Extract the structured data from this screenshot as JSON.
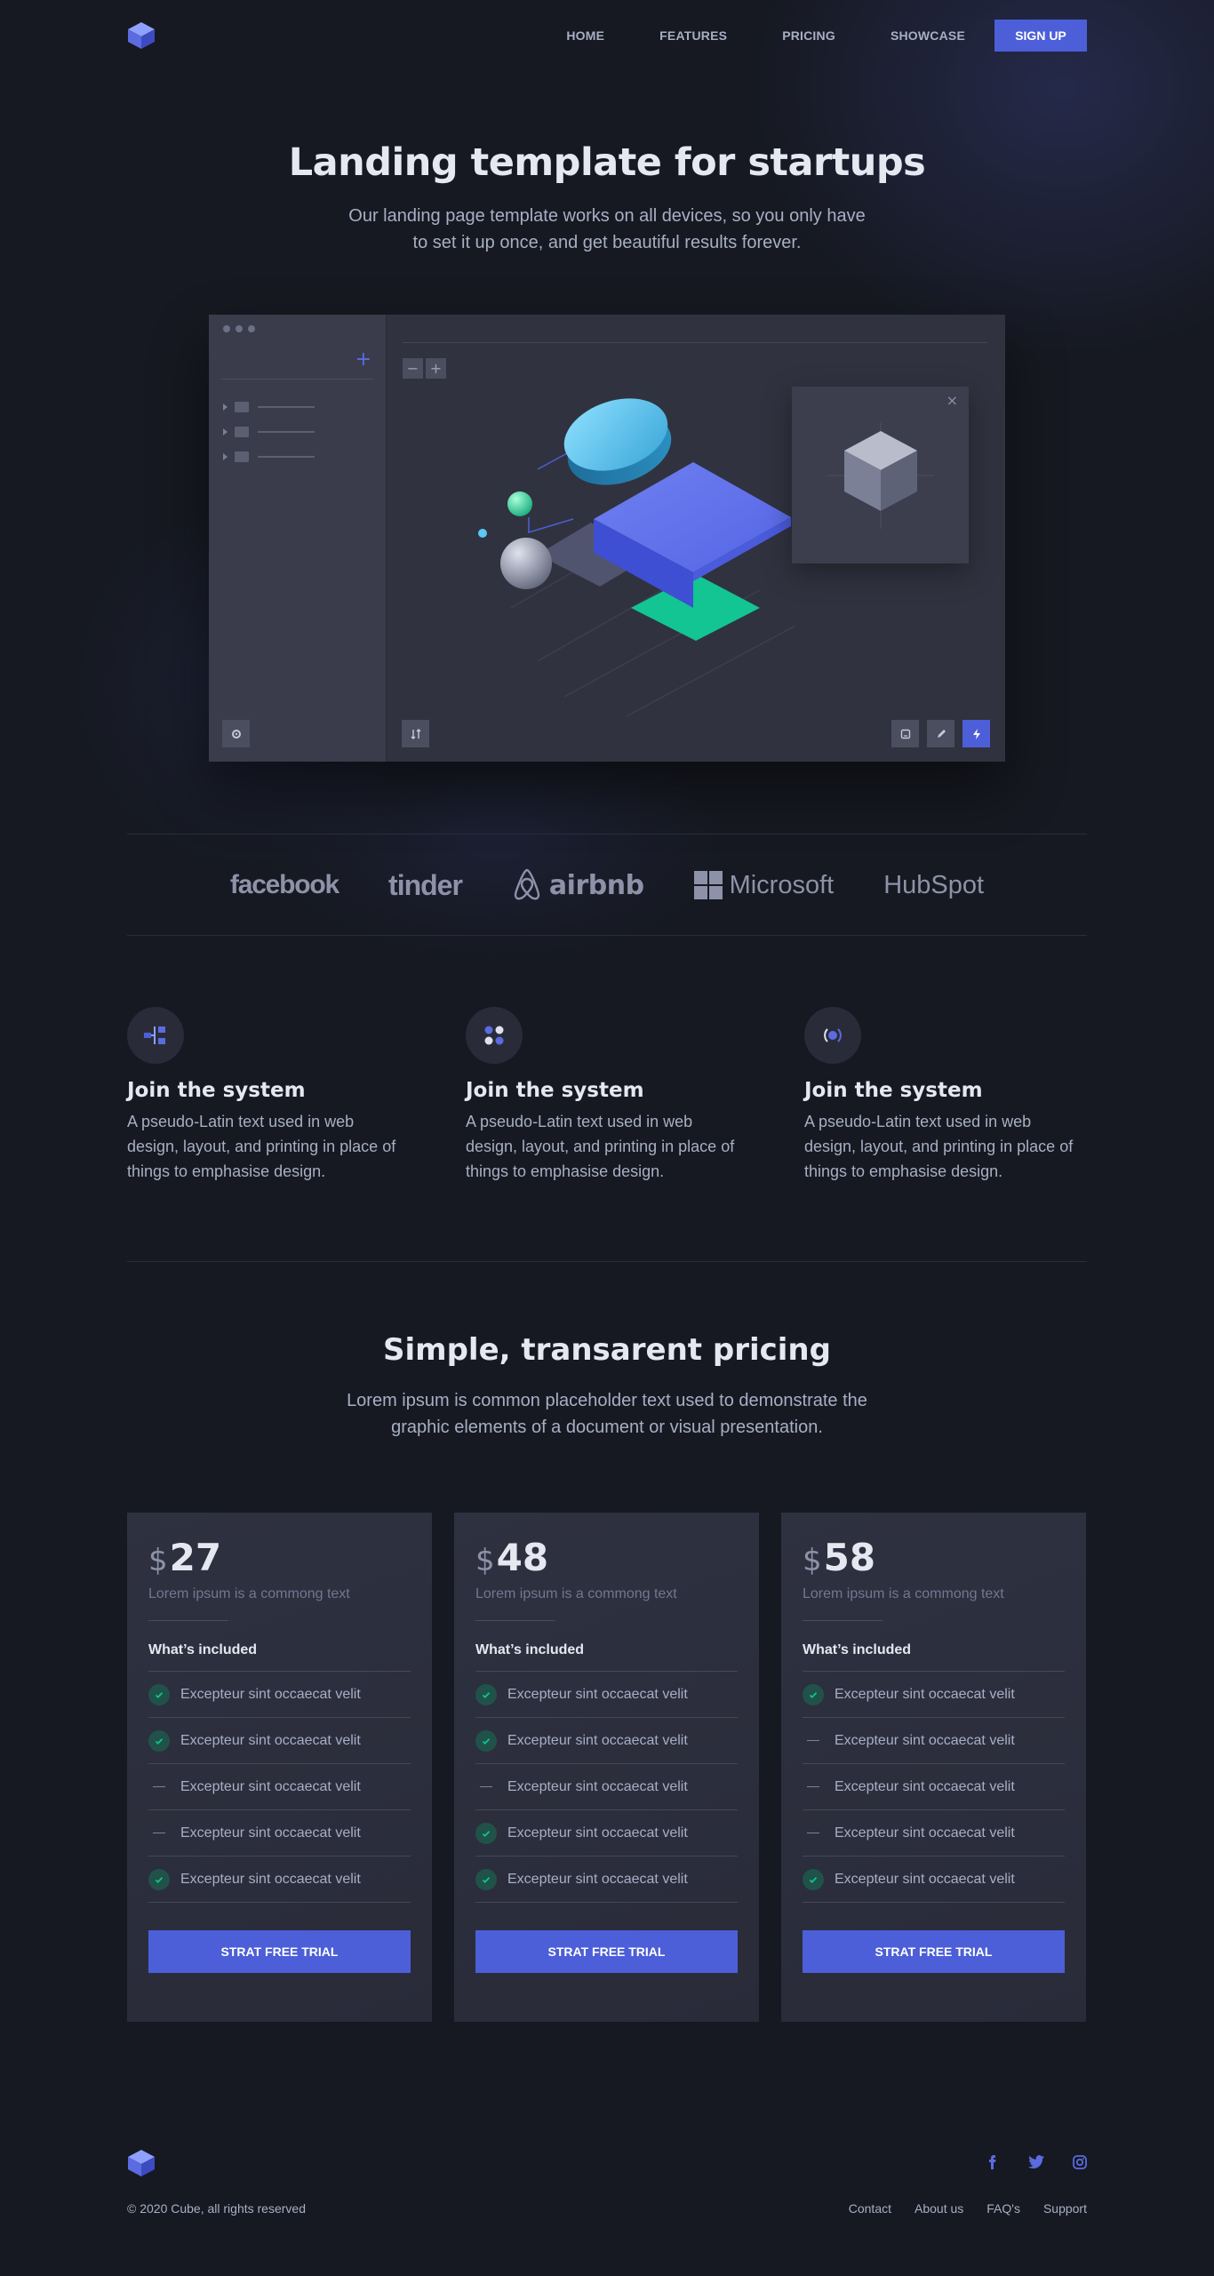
{
  "header": {
    "logo_icon": "cube-logo-icon",
    "nav": [
      "HOME",
      "FEATURES",
      "PRICING",
      "SHOWCASE"
    ],
    "signup_label": "SIGN UP"
  },
  "hero": {
    "title": "Landing template for startups",
    "subtitle": "Our landing page template works on all devices, so you only have to set it up once, and get beautiful results forever."
  },
  "mockup": {
    "sidebar_add_icon": "plus-icon",
    "zoom": [
      "−",
      "+"
    ],
    "panel_close": "×",
    "tools": [
      "gear-icon",
      "sort-icon",
      "tablet-icon",
      "pencil-icon",
      "bolt-icon"
    ]
  },
  "brands": [
    "facebook",
    "tinder",
    "airbnb",
    "Microsoft",
    "HubSpot"
  ],
  "features": [
    {
      "icon": "flow-icon",
      "title": "Join the system",
      "text": "A pseudo-Latin text used in web design, layout, and printing in place of things to emphasise design."
    },
    {
      "icon": "dots-icon",
      "title": "Join the system",
      "text": "A pseudo-Latin text used in web design, layout, and printing in place of things to emphasise design."
    },
    {
      "icon": "target-icon",
      "title": "Join the system",
      "text": "A pseudo-Latin text used in web design, layout, and printing in place of things to emphasise design."
    }
  ],
  "pricing": {
    "title": "Simple, transarent pricing",
    "subtitle": "Lorem ipsum is common placeholder text used to demonstrate the graphic elements of a document or visual presentation.",
    "plans": [
      {
        "currency": "$",
        "price": "27",
        "desc": "Lorem ipsum is a commong text",
        "included_label": "What’s included",
        "items": [
          {
            "label": "Excepteur sint occaecat velit",
            "included": true
          },
          {
            "label": "Excepteur sint occaecat velit",
            "included": true
          },
          {
            "label": "Excepteur sint occaecat velit",
            "included": false
          },
          {
            "label": "Excepteur sint occaecat velit",
            "included": false
          },
          {
            "label": "Excepteur sint occaecat velit",
            "included": true
          }
        ],
        "cta": "STRAT FREE TRIAL"
      },
      {
        "currency": "$",
        "price": "48",
        "desc": "Lorem ipsum is a commong text",
        "included_label": "What’s included",
        "items": [
          {
            "label": "Excepteur sint occaecat velit",
            "included": true
          },
          {
            "label": "Excepteur sint occaecat velit",
            "included": true
          },
          {
            "label": "Excepteur sint occaecat velit",
            "included": false
          },
          {
            "label": "Excepteur sint occaecat velit",
            "included": true
          },
          {
            "label": "Excepteur sint occaecat velit",
            "included": true
          }
        ],
        "cta": "STRAT FREE TRIAL"
      },
      {
        "currency": "$",
        "price": "58",
        "desc": "Lorem ipsum is a commong text",
        "included_label": "What’s included",
        "items": [
          {
            "label": "Excepteur sint occaecat velit",
            "included": true
          },
          {
            "label": "Excepteur sint occaecat velit",
            "included": false
          },
          {
            "label": "Excepteur sint occaecat velit",
            "included": false
          },
          {
            "label": "Excepteur sint occaecat velit",
            "included": false
          },
          {
            "label": "Excepteur sint occaecat velit",
            "included": true
          }
        ],
        "cta": "STRAT FREE TRIAL"
      }
    ]
  },
  "footer": {
    "copyright": "© 2020 Cube, all rights reserved",
    "links": [
      "Contact",
      "About us",
      "FAQ's",
      "Support"
    ],
    "social": [
      "facebook-icon",
      "twitter-icon",
      "instagram-icon"
    ]
  },
  "colors": {
    "background": "#161921",
    "accent": "#4c5fd8",
    "accent_green": "#10c38e",
    "text": "#a8aec4",
    "heading": "#e6e8f1",
    "card": "#2c2f3d"
  }
}
